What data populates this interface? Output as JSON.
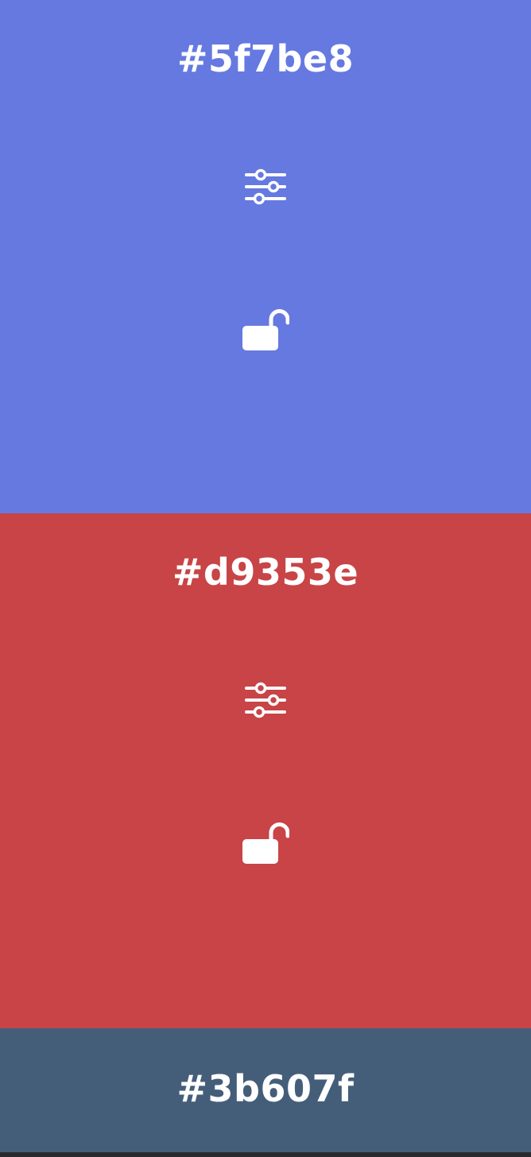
{
  "colors": {
    "bottom_bar": "#2a2a2e",
    "text": "#ffffff"
  },
  "swatches": [
    {
      "hex_label": "#5f7be8",
      "display_color": "#6579e0",
      "icons": [
        "sliders-icon",
        "unlock-icon"
      ]
    },
    {
      "hex_label": "#d9353e",
      "display_color": "#c84446",
      "icons": [
        "sliders-icon",
        "unlock-icon"
      ]
    },
    {
      "hex_label": "#3b607f",
      "display_color": "#445e7a",
      "icons": []
    }
  ]
}
